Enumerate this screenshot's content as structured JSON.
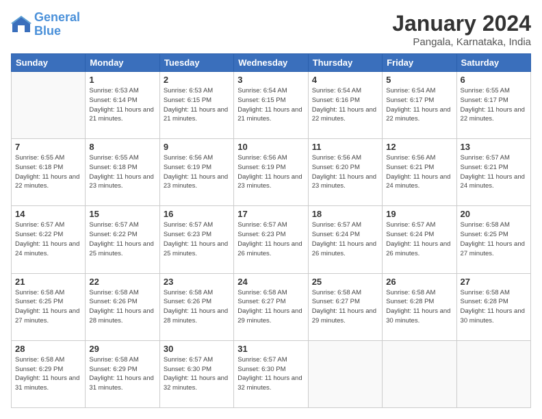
{
  "logo": {
    "line1": "General",
    "line2": "Blue"
  },
  "title": "January 2024",
  "subtitle": "Pangala, Karnataka, India",
  "days_header": [
    "Sunday",
    "Monday",
    "Tuesday",
    "Wednesday",
    "Thursday",
    "Friday",
    "Saturday"
  ],
  "weeks": [
    [
      {
        "day": "",
        "sunrise": "",
        "sunset": "",
        "daylight": ""
      },
      {
        "day": "1",
        "sunrise": "Sunrise: 6:53 AM",
        "sunset": "Sunset: 6:14 PM",
        "daylight": "Daylight: 11 hours and 21 minutes."
      },
      {
        "day": "2",
        "sunrise": "Sunrise: 6:53 AM",
        "sunset": "Sunset: 6:15 PM",
        "daylight": "Daylight: 11 hours and 21 minutes."
      },
      {
        "day": "3",
        "sunrise": "Sunrise: 6:54 AM",
        "sunset": "Sunset: 6:15 PM",
        "daylight": "Daylight: 11 hours and 21 minutes."
      },
      {
        "day": "4",
        "sunrise": "Sunrise: 6:54 AM",
        "sunset": "Sunset: 6:16 PM",
        "daylight": "Daylight: 11 hours and 22 minutes."
      },
      {
        "day": "5",
        "sunrise": "Sunrise: 6:54 AM",
        "sunset": "Sunset: 6:17 PM",
        "daylight": "Daylight: 11 hours and 22 minutes."
      },
      {
        "day": "6",
        "sunrise": "Sunrise: 6:55 AM",
        "sunset": "Sunset: 6:17 PM",
        "daylight": "Daylight: 11 hours and 22 minutes."
      }
    ],
    [
      {
        "day": "7",
        "sunrise": "Sunrise: 6:55 AM",
        "sunset": "Sunset: 6:18 PM",
        "daylight": "Daylight: 11 hours and 22 minutes."
      },
      {
        "day": "8",
        "sunrise": "Sunrise: 6:55 AM",
        "sunset": "Sunset: 6:18 PM",
        "daylight": "Daylight: 11 hours and 23 minutes."
      },
      {
        "day": "9",
        "sunrise": "Sunrise: 6:56 AM",
        "sunset": "Sunset: 6:19 PM",
        "daylight": "Daylight: 11 hours and 23 minutes."
      },
      {
        "day": "10",
        "sunrise": "Sunrise: 6:56 AM",
        "sunset": "Sunset: 6:19 PM",
        "daylight": "Daylight: 11 hours and 23 minutes."
      },
      {
        "day": "11",
        "sunrise": "Sunrise: 6:56 AM",
        "sunset": "Sunset: 6:20 PM",
        "daylight": "Daylight: 11 hours and 23 minutes."
      },
      {
        "day": "12",
        "sunrise": "Sunrise: 6:56 AM",
        "sunset": "Sunset: 6:21 PM",
        "daylight": "Daylight: 11 hours and 24 minutes."
      },
      {
        "day": "13",
        "sunrise": "Sunrise: 6:57 AM",
        "sunset": "Sunset: 6:21 PM",
        "daylight": "Daylight: 11 hours and 24 minutes."
      }
    ],
    [
      {
        "day": "14",
        "sunrise": "Sunrise: 6:57 AM",
        "sunset": "Sunset: 6:22 PM",
        "daylight": "Daylight: 11 hours and 24 minutes."
      },
      {
        "day": "15",
        "sunrise": "Sunrise: 6:57 AM",
        "sunset": "Sunset: 6:22 PM",
        "daylight": "Daylight: 11 hours and 25 minutes."
      },
      {
        "day": "16",
        "sunrise": "Sunrise: 6:57 AM",
        "sunset": "Sunset: 6:23 PM",
        "daylight": "Daylight: 11 hours and 25 minutes."
      },
      {
        "day": "17",
        "sunrise": "Sunrise: 6:57 AM",
        "sunset": "Sunset: 6:23 PM",
        "daylight": "Daylight: 11 hours and 26 minutes."
      },
      {
        "day": "18",
        "sunrise": "Sunrise: 6:57 AM",
        "sunset": "Sunset: 6:24 PM",
        "daylight": "Daylight: 11 hours and 26 minutes."
      },
      {
        "day": "19",
        "sunrise": "Sunrise: 6:57 AM",
        "sunset": "Sunset: 6:24 PM",
        "daylight": "Daylight: 11 hours and 26 minutes."
      },
      {
        "day": "20",
        "sunrise": "Sunrise: 6:58 AM",
        "sunset": "Sunset: 6:25 PM",
        "daylight": "Daylight: 11 hours and 27 minutes."
      }
    ],
    [
      {
        "day": "21",
        "sunrise": "Sunrise: 6:58 AM",
        "sunset": "Sunset: 6:25 PM",
        "daylight": "Daylight: 11 hours and 27 minutes."
      },
      {
        "day": "22",
        "sunrise": "Sunrise: 6:58 AM",
        "sunset": "Sunset: 6:26 PM",
        "daylight": "Daylight: 11 hours and 28 minutes."
      },
      {
        "day": "23",
        "sunrise": "Sunrise: 6:58 AM",
        "sunset": "Sunset: 6:26 PM",
        "daylight": "Daylight: 11 hours and 28 minutes."
      },
      {
        "day": "24",
        "sunrise": "Sunrise: 6:58 AM",
        "sunset": "Sunset: 6:27 PM",
        "daylight": "Daylight: 11 hours and 29 minutes."
      },
      {
        "day": "25",
        "sunrise": "Sunrise: 6:58 AM",
        "sunset": "Sunset: 6:27 PM",
        "daylight": "Daylight: 11 hours and 29 minutes."
      },
      {
        "day": "26",
        "sunrise": "Sunrise: 6:58 AM",
        "sunset": "Sunset: 6:28 PM",
        "daylight": "Daylight: 11 hours and 30 minutes."
      },
      {
        "day": "27",
        "sunrise": "Sunrise: 6:58 AM",
        "sunset": "Sunset: 6:28 PM",
        "daylight": "Daylight: 11 hours and 30 minutes."
      }
    ],
    [
      {
        "day": "28",
        "sunrise": "Sunrise: 6:58 AM",
        "sunset": "Sunset: 6:29 PM",
        "daylight": "Daylight: 11 hours and 31 minutes."
      },
      {
        "day": "29",
        "sunrise": "Sunrise: 6:58 AM",
        "sunset": "Sunset: 6:29 PM",
        "daylight": "Daylight: 11 hours and 31 minutes."
      },
      {
        "day": "30",
        "sunrise": "Sunrise: 6:57 AM",
        "sunset": "Sunset: 6:30 PM",
        "daylight": "Daylight: 11 hours and 32 minutes."
      },
      {
        "day": "31",
        "sunrise": "Sunrise: 6:57 AM",
        "sunset": "Sunset: 6:30 PM",
        "daylight": "Daylight: 11 hours and 32 minutes."
      },
      {
        "day": "",
        "sunrise": "",
        "sunset": "",
        "daylight": ""
      },
      {
        "day": "",
        "sunrise": "",
        "sunset": "",
        "daylight": ""
      },
      {
        "day": "",
        "sunrise": "",
        "sunset": "",
        "daylight": ""
      }
    ]
  ]
}
